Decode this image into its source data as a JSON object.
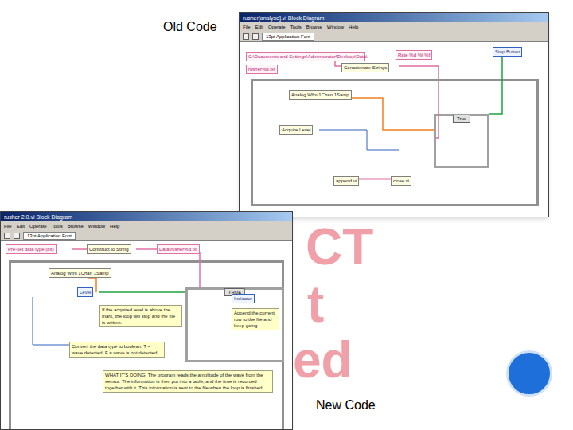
{
  "slide": {
    "labels": [
      {
        "text": "Old Code",
        "kind": "old"
      },
      {
        "text": "New Code",
        "kind": "new"
      }
    ],
    "title_fragments": [
      "CT",
      "t",
      "ed"
    ]
  },
  "windows": [
    {
      "title": "rusher[analyse].vi Block Diagram",
      "menu": [
        "File",
        "Edit",
        "Operate",
        "Tools",
        "Browse",
        "Window",
        "Help"
      ],
      "toolbar_font": "13pt Application Font",
      "case_selector": "True",
      "nodes": [
        {
          "text": "C:\\Documents and Settings\\Administrator\\Desktop\\Data\\",
          "kind": "constant"
        },
        {
          "text": "rusher%d.txt",
          "kind": "constant"
        },
        {
          "text": "Concatenate Strings",
          "kind": "function"
        },
        {
          "text": "Rate %d %f %f",
          "kind": "constant"
        },
        {
          "text": "Stop Button",
          "kind": "indicator"
        },
        {
          "text": "Analog Wfm 1Chan 1Samp",
          "kind": "function"
        },
        {
          "text": "Acquire Level",
          "kind": "function"
        },
        {
          "text": "append.vi",
          "kind": "function"
        },
        {
          "text": "close.vi",
          "kind": "function"
        }
      ]
    },
    {
      "title": "rusher 2.0.vi Block Diagram",
      "menu": [
        "File",
        "Edit",
        "Operate",
        "Tools",
        "Browse",
        "Window",
        "Help"
      ],
      "toolbar_font": "13pt Application Font",
      "case_selector": "TRUE",
      "nodes": [
        {
          "text": "Pre-set data type (bit)",
          "kind": "constant"
        },
        {
          "text": "Construct to String",
          "kind": "function"
        },
        {
          "text": "Data\\rusher%d.txt",
          "kind": "constant"
        },
        {
          "text": "Analog Wfm 1Chan 1Samp",
          "kind": "function"
        },
        {
          "text": "Level",
          "kind": "indicator"
        },
        {
          "text": "If the acquired level is above the mark, the loop will stop and the file is written.",
          "kind": "comment"
        },
        {
          "text": "Convert the data type to boolean: T = wave detected, F = wave is not detected",
          "kind": "comment"
        },
        {
          "text": "WHAT IT'S DOING: The program reads the amplitude of the wave from the sensor. The information is then put into a table, and the time is recorded together with it. This information is sent to the file when the loop is finished.",
          "kind": "comment"
        },
        {
          "text": "Append the current row to the file and keep going",
          "kind": "comment"
        },
        {
          "text": "Indicator",
          "kind": "indicator"
        }
      ]
    }
  ]
}
